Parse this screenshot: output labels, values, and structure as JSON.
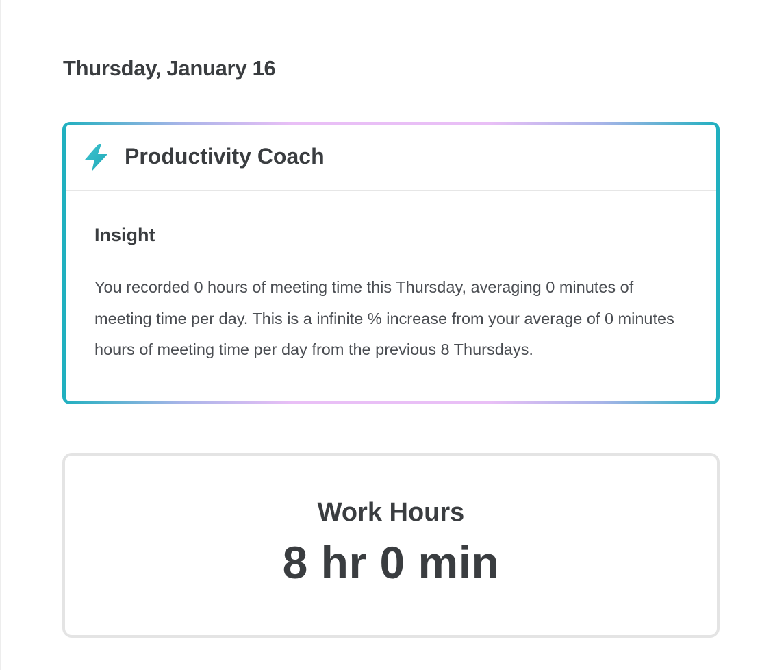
{
  "date_heading": "Thursday, January 16",
  "coach": {
    "icon": "lightning-bolt-icon",
    "title": "Productivity Coach",
    "insight_label": "Insight",
    "insight_text": "You recorded 0 hours of meeting time this Thursday, averaging 0 minutes of meeting time per day. This is a infinite % increase from your average of 0 minutes hours of meeting time per day from the previous 8 Thursdays.",
    "accent_color": "#1fb0bf",
    "gradient_colors": [
      "#1fb0bf",
      "#e9bff6"
    ]
  },
  "work_hours": {
    "label": "Work Hours",
    "value": "8 hr 0 min"
  }
}
